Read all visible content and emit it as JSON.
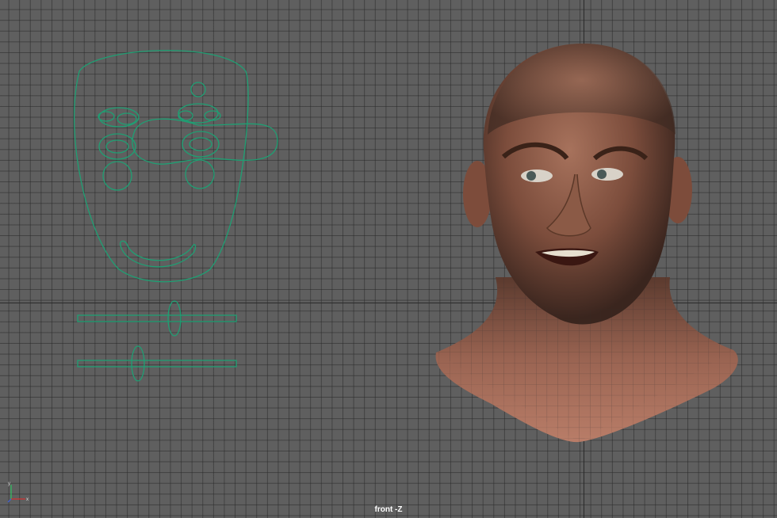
{
  "viewport": {
    "camera_label": "front -Z",
    "grid_color": "#5f5f5f",
    "rig_color": "#1f9f73",
    "skin_color": "#8a5844"
  },
  "axis_gizmo": {
    "x_label": "x",
    "y_label": "y",
    "x_color": "#d23030",
    "y_color": "#30c060",
    "z_color": "#4060e0"
  }
}
